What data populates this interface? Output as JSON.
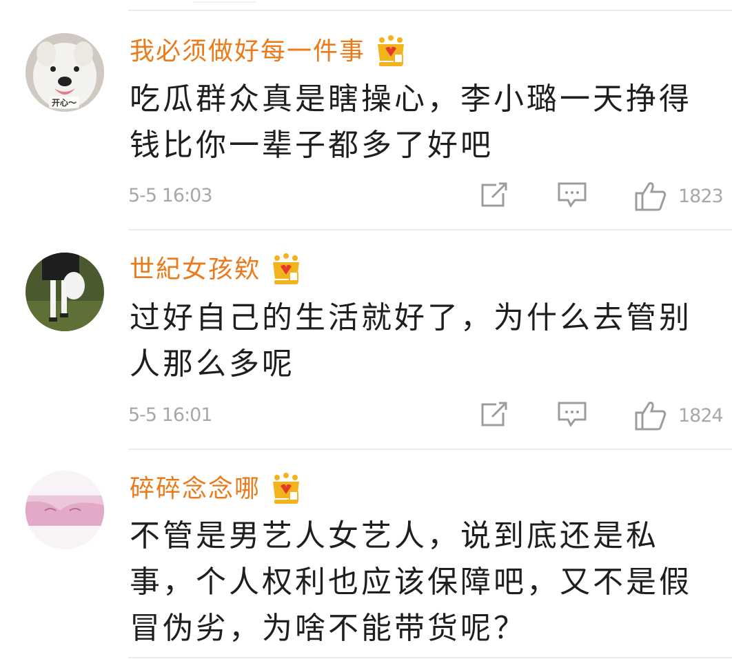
{
  "comments": [
    {
      "user": "我必须做好每一件事",
      "avatar_caption": "开心～",
      "line1": "吃瓜群众真是瞎操心，李小璐一天挣得",
      "line2": "钱比你一辈子都多了好吧",
      "time": "5-5 16:03",
      "likes": "1823",
      "badge_icon": "crown-badge-icon"
    },
    {
      "user": "世紀女孩欸",
      "line1": "过好自己的生活就好了，为什么去管别",
      "line2": "人那么多呢",
      "time": "5-5 16:01",
      "likes": "1824",
      "badge_icon": "crown-badge-icon"
    },
    {
      "user": "碎碎念念哪",
      "line1": "不管是男艺人女艺人，说到底还是私",
      "line2": "事，个人权利也应该保障吧，又不是假",
      "line3": "冒伪劣，为啥不能带货呢？",
      "badge_icon": "crown-badge-icon"
    }
  ],
  "colors": {
    "username": "#eb7b1a",
    "text": "#1e1e1e",
    "meta": "#a8a8a8",
    "divider": "#ebebeb",
    "crown": "#f2b31c"
  }
}
